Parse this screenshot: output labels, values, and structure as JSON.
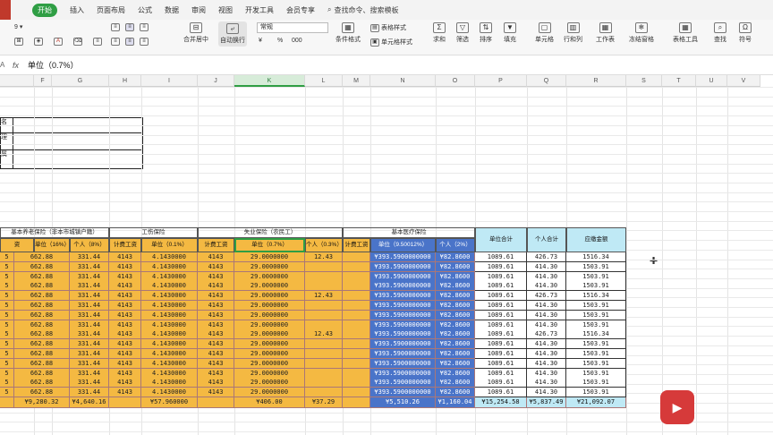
{
  "menubar": {
    "tabs": [
      "开始",
      "插入",
      "页面布局",
      "公式",
      "数据",
      "审阅",
      "视图",
      "开发工具",
      "会员专享"
    ],
    "search": "查找命令、搜索模板"
  },
  "ribbon": {
    "font_size": "9",
    "merge": "合并居中",
    "wrap": "自动换行",
    "number_format": "常规",
    "currency": "¥",
    "percent": "%",
    "thousands": "000",
    "table_style": "表格样式",
    "cond_format": "条件格式",
    "cell_style": "单元格样式",
    "sum": "求和",
    "filter": "筛选",
    "sort": "排序",
    "fill": "填充",
    "cell": "单元格",
    "rowcol": "行和列",
    "worksheet": "工作表",
    "freeze": "冻结窗格",
    "table_tools": "表格工具",
    "find": "查找",
    "symbol": "符号"
  },
  "formula_bar": {
    "cell_ref": "A",
    "fx": "fx",
    "content": "单位（0.7%）"
  },
  "columns": [
    "F",
    "G",
    "H",
    "I",
    "J",
    "K",
    "L",
    "M",
    "N",
    "O",
    "P",
    "Q",
    "R",
    "S",
    "T",
    "U",
    "V"
  ],
  "selected_column": "K",
  "info_box": {
    "labels": [
      "名",
      "理",
      "属"
    ]
  },
  "table": {
    "groups": {
      "pension": "基本养老保险（非本市城镇户籍）",
      "injury": "工伤保险",
      "unemployment": "失业保险（农民工）",
      "medical": "基本医疗保险",
      "unit_total": "单位合计",
      "personal_total": "个人合计",
      "payable": "应缴金额"
    },
    "subheaders": {
      "pension_base": "资",
      "pension_unit": "单位（16%）",
      "pension_personal": "个人（8%）",
      "injury_base": "计费工资",
      "injury_unit": "单位（0.1%）",
      "unemp_base": "计费工资",
      "unemp_unit": "单位（0.7%）",
      "unemp_personal": "个人（0.3%）",
      "medical_base": "计费工资",
      "medical_unit": "单位（9.50012%）",
      "medical_personal": "个人（2%）"
    },
    "rows": [
      [
        "5",
        "662.88",
        "331.44",
        "4143",
        "4.1430000",
        "4143",
        "29.0000000",
        "12.43",
        "",
        "¥393.5900000000",
        "¥82.8600",
        "1089.61",
        "426.73",
        "1516.34"
      ],
      [
        "5",
        "662.88",
        "331.44",
        "4143",
        "4.1430000",
        "4143",
        "29.0000000",
        "",
        "",
        "¥393.5900000000",
        "¥82.8600",
        "1089.61",
        "414.30",
        "1503.91"
      ],
      [
        "5",
        "662.88",
        "331.44",
        "4143",
        "4.1430000",
        "4143",
        "29.0000000",
        "",
        "",
        "¥393.5900000000",
        "¥82.8600",
        "1089.61",
        "414.30",
        "1503.91"
      ],
      [
        "5",
        "662.88",
        "331.44",
        "4143",
        "4.1430000",
        "4143",
        "29.0000000",
        "",
        "",
        "¥393.5900000000",
        "¥82.8600",
        "1089.61",
        "414.30",
        "1503.91"
      ],
      [
        "5",
        "662.88",
        "331.44",
        "4143",
        "4.1430000",
        "4143",
        "29.0000000",
        "12.43",
        "",
        "¥393.5900000000",
        "¥82.8600",
        "1089.61",
        "426.73",
        "1516.34"
      ],
      [
        "5",
        "662.88",
        "331.44",
        "4143",
        "4.1430000",
        "4143",
        "29.0000000",
        "",
        "",
        "¥393.5900000000",
        "¥82.8600",
        "1089.61",
        "414.30",
        "1503.91"
      ],
      [
        "5",
        "662.88",
        "331.44",
        "4143",
        "4.1430000",
        "4143",
        "29.0000000",
        "",
        "",
        "¥393.5900000000",
        "¥82.8600",
        "1089.61",
        "414.30",
        "1503.91"
      ],
      [
        "5",
        "662.88",
        "331.44",
        "4143",
        "4.1430000",
        "4143",
        "29.0000000",
        "",
        "",
        "¥393.5900000000",
        "¥82.8600",
        "1089.61",
        "414.30",
        "1503.91"
      ],
      [
        "5",
        "662.88",
        "331.44",
        "4143",
        "4.1430000",
        "4143",
        "29.0000000",
        "12.43",
        "",
        "¥393.5900000000",
        "¥82.8600",
        "1089.61",
        "426.73",
        "1516.34"
      ],
      [
        "5",
        "662.88",
        "331.44",
        "4143",
        "4.1430000",
        "4143",
        "29.0000000",
        "",
        "",
        "¥393.5900000000",
        "¥82.8600",
        "1089.61",
        "414.30",
        "1503.91"
      ],
      [
        "5",
        "662.88",
        "331.44",
        "4143",
        "4.1430000",
        "4143",
        "29.0000000",
        "",
        "",
        "¥393.5900000000",
        "¥82.8600",
        "1089.61",
        "414.30",
        "1503.91"
      ],
      [
        "5",
        "662.88",
        "331.44",
        "4143",
        "4.1430000",
        "4143",
        "29.0000000",
        "",
        "",
        "¥393.5900000000",
        "¥82.8600",
        "1089.61",
        "414.30",
        "1503.91"
      ],
      [
        "5",
        "662.88",
        "331.44",
        "4143",
        "4.1430000",
        "4143",
        "29.0000000",
        "",
        "",
        "¥393.5900000000",
        "¥82.8600",
        "1089.61",
        "414.30",
        "1503.91"
      ],
      [
        "5",
        "662.88",
        "331.44",
        "4143",
        "4.1430000",
        "4143",
        "29.0000000",
        "",
        "",
        "¥393.5900000000",
        "¥82.8600",
        "1089.61",
        "414.30",
        "1503.91"
      ],
      [
        "5",
        "662.88",
        "331.44",
        "4143",
        "4.1430000",
        "4143",
        "29.0000000",
        "",
        "",
        "¥393.5900000000",
        "¥82.8600",
        "1089.61",
        "414.30",
        "1503.91"
      ]
    ],
    "totals": [
      "",
      "¥9,280.32",
      "¥4,640.16",
      "",
      "¥57.960000",
      "",
      "¥406.00",
      "¥37.29",
      "",
      "¥5,510.26",
      "¥1,160.04",
      "¥15,254.58",
      "¥5,837.49",
      "¥21,092.07"
    ]
  },
  "colors": {
    "accent": "#2f9e44",
    "orange": "#f4b942",
    "blue": "#4a74c9",
    "cyan": "#bfe9f5"
  }
}
